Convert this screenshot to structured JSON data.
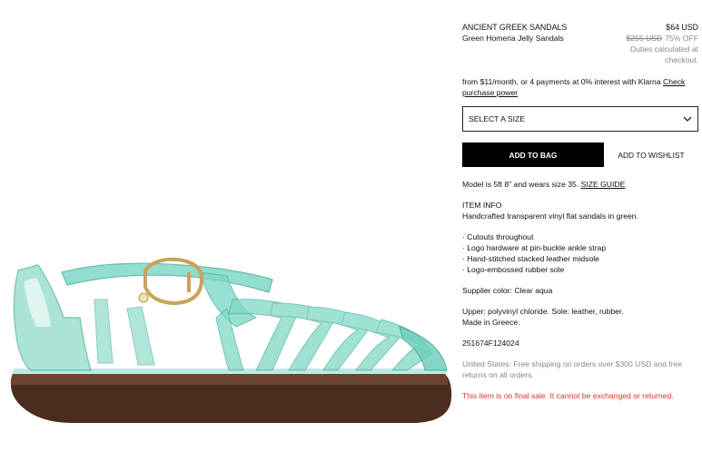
{
  "product": {
    "brand": "ANCIENT GREEK SANDALS",
    "name": "Green Homeria Jelly Sandals",
    "price": "$64 USD",
    "original_price": "$255 USD",
    "discount": "75% OFF",
    "duties": "Duties calculated at checkout."
  },
  "klarna": {
    "text": "from $11/month, or 4 payments at 0% interest with Klarna",
    "link": "Check purchase power"
  },
  "size_select": {
    "label": "SELECT A SIZE"
  },
  "buttons": {
    "add_to_bag": "ADD TO BAG",
    "add_to_wishlist": "ADD TO WISHLIST"
  },
  "model": {
    "text": "Model is 5ft 8\" and wears size 35.",
    "size_guide": "SIZE GUIDE"
  },
  "item_info": {
    "heading": "ITEM INFO",
    "description": "Handcrafted transparent vinyl flat sandals in green.",
    "bullets": [
      "· Cutouts throughout",
      "· Logo hardware at pin-buckle ankle strap",
      "· Hand-stitched stacked leather midsole",
      "· Logo-embossed rubber sole"
    ],
    "supplier_color": "Supplier color: Clear aqua",
    "materials": "Upper: polyvinyl chloride. Sole: leather, rubber.",
    "origin": "Made in Greece.",
    "sku": "251674F124024"
  },
  "shipping": "United States: Free shipping on orders over $300 USD and free returns on all orders.",
  "final_sale": "This item is on final sale. It cannot be exchanged or returned.",
  "colors": {
    "aqua": "#7fd9c6",
    "sole": "#4a2d1c",
    "warning": "#e0301e",
    "buckle": "#c9a35c"
  }
}
